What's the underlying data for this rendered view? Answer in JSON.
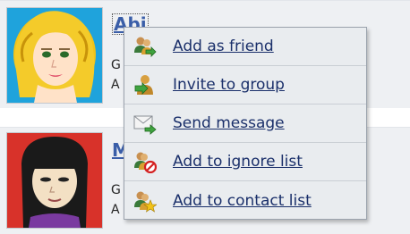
{
  "users": [
    {
      "name": "Abi",
      "line1": "G",
      "line2": "A",
      "avatar_icon": "blonde-girl-avatar-icon"
    },
    {
      "name": "M",
      "line1": "G",
      "line2": "A",
      "avatar_icon": "dark-hair-girl-avatar-icon"
    }
  ],
  "menu": {
    "items": [
      {
        "label": "Add as friend",
        "icon": "add-friend-icon"
      },
      {
        "label": "Invite to group",
        "icon": "invite-group-icon"
      },
      {
        "label": "Send message",
        "icon": "send-message-icon"
      },
      {
        "label": "Add to ignore list",
        "icon": "ignore-user-icon"
      },
      {
        "label": "Add to contact list",
        "icon": "add-contact-icon"
      }
    ]
  },
  "colors": {
    "link": "#3a5ea8",
    "menu_text": "#1a2f6a",
    "menu_bg": "#e9ecef",
    "card_bg": "#eef0f3"
  }
}
